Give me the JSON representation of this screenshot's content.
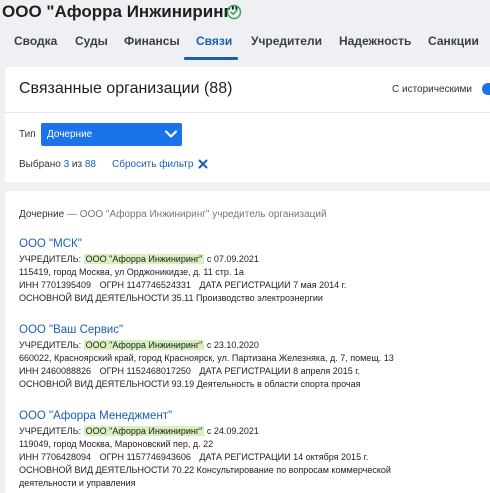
{
  "company": {
    "title": "ООО \"Афорра Инжиниринг\""
  },
  "tabs": [
    {
      "label": "Сводка"
    },
    {
      "label": "Суды"
    },
    {
      "label": "Финансы"
    },
    {
      "label": "Связи"
    },
    {
      "label": "Учредители"
    },
    {
      "label": "Надежность"
    },
    {
      "label": "Санкции"
    }
  ],
  "active_tab": "Связи",
  "section": {
    "title": "Связанные организации (88)",
    "historical_label": "С историческими",
    "historical_on": true
  },
  "filter": {
    "type_label": "Тип",
    "type_value": "Дочерние",
    "selected_prefix": "Выбрано",
    "selected_count": "3",
    "selected_of": "из",
    "selected_total": "88",
    "reset_label": "Сбросить фильтр"
  },
  "group": {
    "title": "Дочерние",
    "subtitle": "— ООО \"Афорра Инжиниринг\" учредитель организаций"
  },
  "organizations": [
    {
      "name": "ООО \"МСК\"",
      "founder_label": "УЧРЕДИТЕЛЬ:",
      "founder": "ООО \"Афорра Инжиниринг\"",
      "founder_since": "с 07.09.2021",
      "address": "115419, город Москва, ул Орджоникидзе, д. 11 стр. 1а",
      "inn_label": "ИНН",
      "inn": "7701395409",
      "ogrn_label": "ОГРН",
      "ogrn": "1147746524331",
      "reg_label": "ДАТА РЕГИСТРАЦИИ",
      "reg_date": "7 мая 2014 г.",
      "activity_label": "ОСНОВНОЙ ВИД ДЕЯТЕЛЬНОСТИ",
      "activity": "35.11 Производство электроэнергии"
    },
    {
      "name": "ООО \"Ваш Сервис\"",
      "founder_label": "УЧРЕДИТЕЛЬ:",
      "founder": "ООО \"Афорра Инжиниринг\"",
      "founder_since": "с 23.10.2020",
      "address": "660022, Красноярский край, город Красноярск, ул. Партизана Железняка, д. 7, помещ. 13",
      "inn_label": "ИНН",
      "inn": "2460088826",
      "ogrn_label": "ОГРН",
      "ogrn": "1152468017250",
      "reg_label": "ДАТА РЕГИСТРАЦИИ",
      "reg_date": "8 апреля 2015 г.",
      "activity_label": "ОСНОВНОЙ ВИД ДЕЯТЕЛЬНОСТИ",
      "activity": "93.19 Деятельность в области спорта прочая"
    },
    {
      "name": "ООО \"Афорра Менеджмент\"",
      "founder_label": "УЧРЕДИТЕЛЬ:",
      "founder": "ООО \"Афорра Инжиниринг\"",
      "founder_since": "с 24.09.2021",
      "address": "119049, город Москва, Мароновский пер, д. 22",
      "inn_label": "ИНН",
      "inn": "7706428094",
      "ogrn_label": "ОГРН",
      "ogrn": "1157746943606",
      "reg_label": "ДАТА РЕГИСТРАЦИИ",
      "reg_date": "14 октября 2015 г.",
      "activity_label": "ОСНОВНОЙ ВИД ДЕЯТЕЛЬНОСТИ",
      "activity": "70.22 Консультирование по вопросам коммерческой",
      "activity_cont": "деятельности и управления"
    }
  ],
  "colors": {
    "accent": "#1a73e8",
    "link": "#1a5fb4",
    "highlight": "#d8efbe",
    "verified": "#3aa655"
  }
}
